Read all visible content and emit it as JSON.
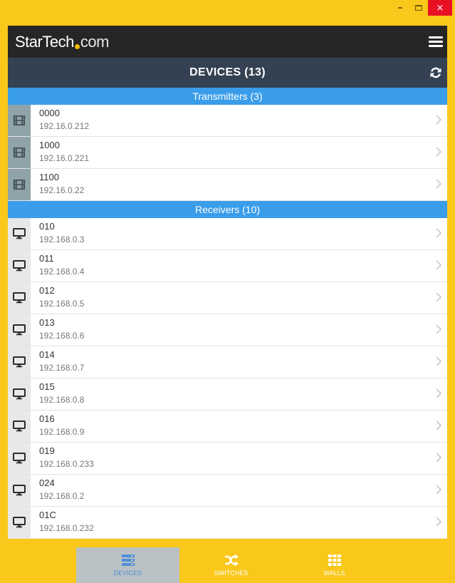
{
  "window": {
    "minimize_glyph": "–",
    "close_glyph": "×"
  },
  "brand": {
    "logo_part1": "StarTech",
    "logo_part2": "com",
    "menu_icon": "hamburger-icon"
  },
  "header": {
    "title": "DEVICES (13)",
    "refresh_icon": "refresh-icon"
  },
  "transmitters": {
    "heading": "Transmitters (3)",
    "icon": "film-icon",
    "items": [
      {
        "name": "0000",
        "ip": "192.16.0.212"
      },
      {
        "name": "1000",
        "ip": "192.16.0.221"
      },
      {
        "name": "1100",
        "ip": "192.16.0.22"
      }
    ]
  },
  "receivers": {
    "heading": "Receivers (10)",
    "icon": "monitor-icon",
    "items": [
      {
        "name": "010",
        "ip": "192.168.0.3"
      },
      {
        "name": "011",
        "ip": "192.168.0.4"
      },
      {
        "name": "012",
        "ip": "192.168.0.5"
      },
      {
        "name": "013",
        "ip": "192.168.0.6"
      },
      {
        "name": "014",
        "ip": "192.168.0.7"
      },
      {
        "name": "015",
        "ip": "192.168.0.8"
      },
      {
        "name": "016",
        "ip": "192.168.0.9"
      },
      {
        "name": "019",
        "ip": "192.168.0.233"
      },
      {
        "name": "024",
        "ip": "192.168.0.2"
      },
      {
        "name": "01C",
        "ip": "192.168.0.232"
      }
    ]
  },
  "tabs": {
    "devices": {
      "label": "DEVICES",
      "icon": "server-stack-icon",
      "active": true
    },
    "switches": {
      "label": "SWITCHES",
      "icon": "shuffle-icon",
      "active": false
    },
    "walls": {
      "label": "WALLS",
      "icon": "grid-icon",
      "active": false
    }
  },
  "colors": {
    "window_frame": "#F9C81A",
    "brand_bar": "#262626",
    "header_bar": "#344153",
    "section_blue": "#3A9DEA",
    "close_red": "#E81123",
    "active_tab": "#BAC1C4",
    "active_tab_text": "#4F8FD8"
  }
}
